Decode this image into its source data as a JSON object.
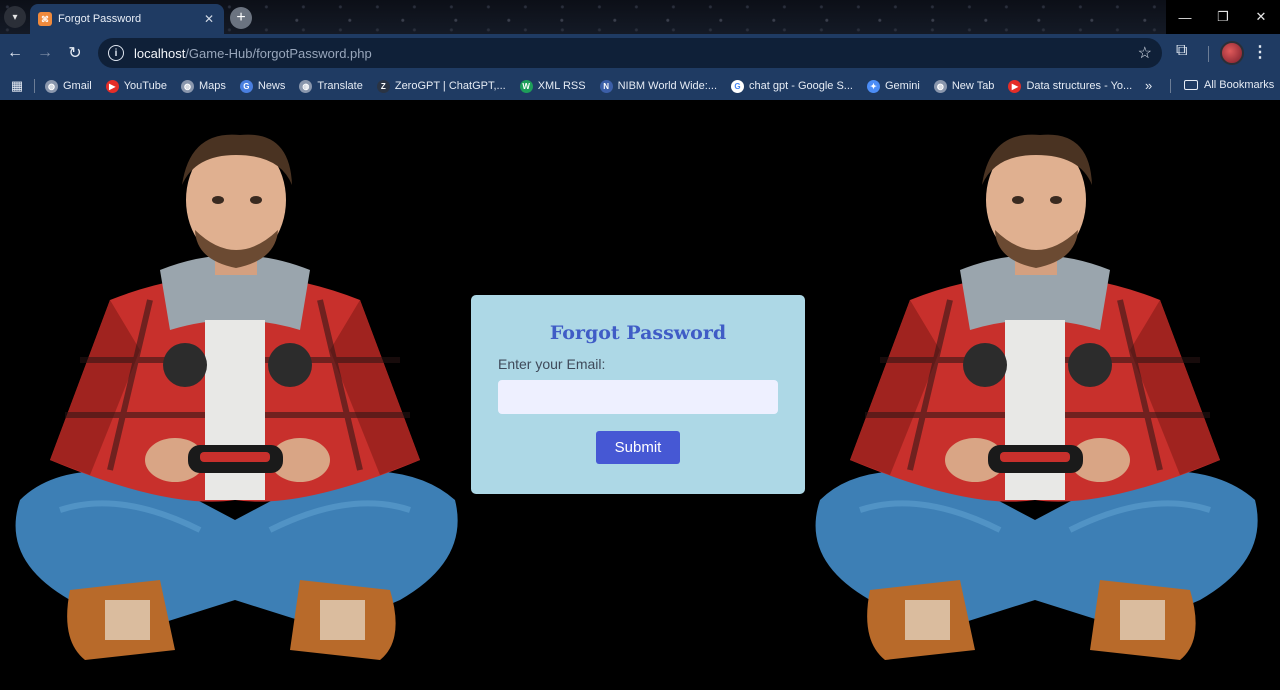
{
  "browser": {
    "tab": {
      "title": "Forgot Password",
      "favicon": "xampp-icon"
    },
    "address": {
      "host": "localhost",
      "path": "/Game-Hub/forgotPassword.php"
    },
    "bookmarks": [
      {
        "label": "Gmail",
        "icon": "globe-icon",
        "color": "#8a97ad"
      },
      {
        "label": "YouTube",
        "icon": "youtube-icon",
        "color": "#e52d27"
      },
      {
        "label": "Maps",
        "icon": "globe-icon",
        "color": "#8a97ad"
      },
      {
        "label": "News",
        "icon": "google-news-icon",
        "color": "#4a7fe0"
      },
      {
        "label": "Translate",
        "icon": "globe-icon",
        "color": "#8a97ad"
      },
      {
        "label": "ZeroGPT | ChatGPT,...",
        "icon": "zerogpt-icon",
        "color": "#2a3444"
      },
      {
        "label": "XML RSS",
        "icon": "w-icon",
        "color": "#1e9e5a"
      },
      {
        "label": "NIBM World Wide:...",
        "icon": "nibm-icon",
        "color": "#3c5fa8"
      },
      {
        "label": "chat gpt - Google S...",
        "icon": "google-icon",
        "color": "#ffffff"
      },
      {
        "label": "Gemini",
        "icon": "gemini-icon",
        "color": "#4c8df6"
      },
      {
        "label": "New Tab",
        "icon": "globe-icon",
        "color": "#8a97ad"
      },
      {
        "label": "Data structures - Yo...",
        "icon": "youtube-icon",
        "color": "#e52d27"
      }
    ],
    "all_bookmarks": "All Bookmarks"
  },
  "page": {
    "title": "Forgot Password",
    "email_label": "Enter your Email:",
    "email_value": "",
    "submit_label": "Submit",
    "colors": {
      "card_bg": "#add8e6",
      "title": "#3f5cc6",
      "button": "#4658d4"
    }
  }
}
